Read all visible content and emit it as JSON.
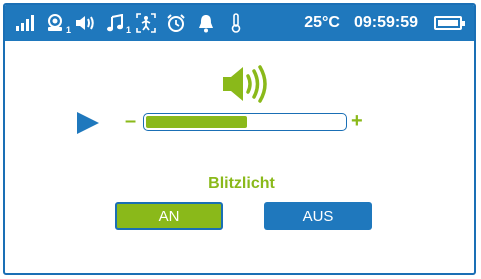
{
  "status_bar": {
    "icons": [
      {
        "name": "signal-icon"
      },
      {
        "name": "baby-unit-icon",
        "sub": "1"
      },
      {
        "name": "volume-icon"
      },
      {
        "name": "music-icon",
        "sub": "1"
      },
      {
        "name": "motion-sensor-icon"
      },
      {
        "name": "alarm-clock-icon"
      },
      {
        "name": "bell-icon"
      },
      {
        "name": "thermometer-icon"
      }
    ],
    "temperature": "25°C",
    "time": "09:59:59",
    "battery_icon": "battery-full-icon"
  },
  "volume": {
    "icon": "speaker-icon",
    "minus_label": "–",
    "plus_label": "+",
    "level": 0.51
  },
  "flash": {
    "label": "Blitzlicht",
    "on_label": "AN",
    "off_label": "AUS",
    "selected": "AN"
  },
  "colors": {
    "accent_blue": "#1f78bd",
    "accent_green": "#8ab91a",
    "background": "#ffffff"
  }
}
